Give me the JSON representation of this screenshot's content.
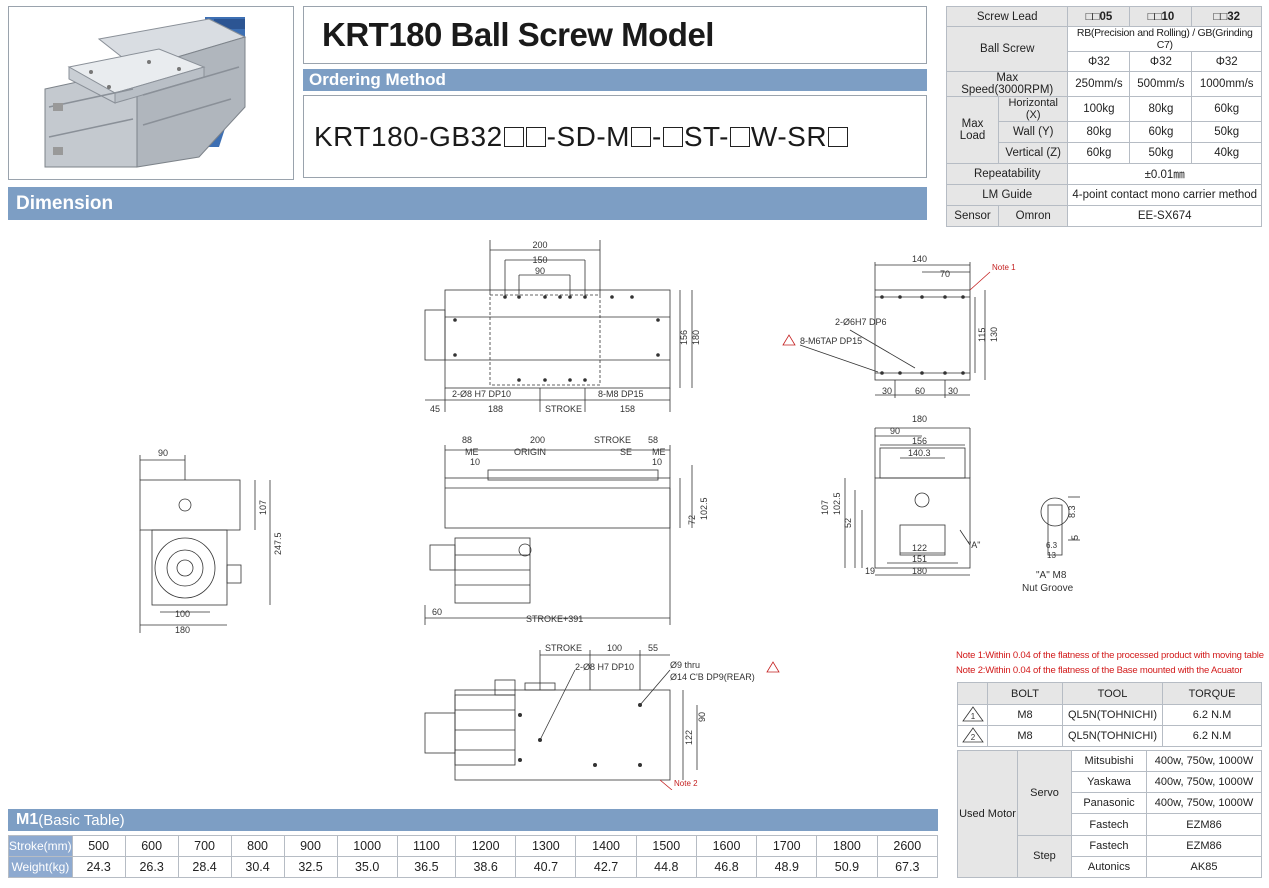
{
  "title": "KRT180 Ball Screw Model",
  "ordering": {
    "header": "Ordering Method",
    "code_parts": [
      "KRT180-GB32",
      "-SD-M",
      "-",
      "ST-",
      "W-SR"
    ]
  },
  "dimension_header": "Dimension",
  "spec": {
    "screw_lead_label": "Screw Lead",
    "leads": [
      "05",
      "10",
      "32"
    ],
    "ball_screw_label": "Ball Screw",
    "ball_screw_type": "RB(Precision and Rolling) / GB(Grinding C7)",
    "diameters": [
      "Φ32",
      "Φ32",
      "Φ32"
    ],
    "max_speed_label": "Max Speed(3000RPM)",
    "max_speeds": [
      "250mm/s",
      "500mm/s",
      "1000mm/s"
    ],
    "max_load_label": "Max Load",
    "loads": [
      {
        "label": "Horizontal (X)",
        "values": [
          "100kg",
          "80kg",
          "60kg"
        ]
      },
      {
        "label": "Wall (Y)",
        "values": [
          "80kg",
          "60kg",
          "50kg"
        ]
      },
      {
        "label": "Vertical (Z)",
        "values": [
          "60kg",
          "50kg",
          "40kg"
        ]
      }
    ],
    "repeatability_label": "Repeatability",
    "repeatability": "±0.01㎜",
    "lm_label": "LM Guide",
    "lm_value": "4-point contact mono carrier method",
    "sensor_label": "Sensor",
    "sensor_brand": "Omron",
    "sensor_model": "EE-SX674"
  },
  "drawing": {
    "top": {
      "d200": "200",
      "d150": "150",
      "d90": "90",
      "d156": "156",
      "d180": "180",
      "hole1": "2-Ø8 H7 DP10",
      "hole2": "8-M8 DP15",
      "d45": "45",
      "d188": "188",
      "stroke": "STROKE",
      "d158": "158"
    },
    "front": {
      "d88": "88",
      "d200": "200",
      "stroke": "STROKE",
      "d58": "58",
      "me": "ME",
      "se": "SE",
      "d10": "10",
      "origin": "ORIGIN",
      "d72": "72",
      "d102": "102.5",
      "d60": "60",
      "total": "STROKE+391"
    },
    "left": {
      "d90": "90",
      "d107": "107",
      "d247": "247.5",
      "d100": "100",
      "d180": "180"
    },
    "table": {
      "d140": "140",
      "d70": "70",
      "note1": "Note 1",
      "hole1": "2-Ø6H7 DP6",
      "hole2": "8-M6TAP DP15",
      "d115": "115",
      "d130": "130",
      "d30a": "30",
      "d60": "60",
      "d30b": "30"
    },
    "end": {
      "d180": "180",
      "d90": "90",
      "d156": "156",
      "d140": "140.3",
      "d107": "107",
      "d102": "102.5",
      "d52": "52",
      "d122": "122",
      "d151": "151",
      "d180b": "180",
      "d19": "19",
      "a": "\"A\""
    },
    "groove": {
      "label": "\"A\" M8",
      "label2": "Nut Groove",
      "d83": "8.3",
      "d5": "5",
      "d63": "6.3",
      "d13": "13"
    },
    "bottom": {
      "stroke": "STROKE",
      "d100": "100",
      "d55": "55",
      "hole1": "2-Ø8 H7 DP10",
      "hole2": "Ø9 thru",
      "hole3": "Ø14 C'B DP9(REAR)",
      "d90": "90",
      "d122": "122",
      "note2": "Note 2"
    }
  },
  "notes": [
    "Note 1:Within 0.04 of the flatness of the processed product with moving table",
    "Note 2:Within 0.04 of the flatness of the Base mounted with the Acuator"
  ],
  "bolt_table": {
    "headers": [
      "BOLT",
      "TOOL",
      "TORQUE"
    ],
    "rows": [
      {
        "mark": "1",
        "bolt": "M8",
        "tool": "QL5N(TOHNICHI)",
        "torque": "6.2 N.M"
      },
      {
        "mark": "2",
        "bolt": "M8",
        "tool": "QL5N(TOHNICHI)",
        "torque": "6.2 N.M"
      }
    ]
  },
  "motor_table": {
    "label": "Used Motor",
    "servo_label": "Servo",
    "step_label": "Step",
    "servo": [
      {
        "brand": "Mitsubishi",
        "value": "400w, 750w, 1000W"
      },
      {
        "brand": "Yaskawa",
        "value": "400w, 750w, 1000W"
      },
      {
        "brand": "Panasonic",
        "value": "400w, 750w, 1000W"
      },
      {
        "brand": "Fastech",
        "value": "EZM86"
      }
    ],
    "step": [
      {
        "brand": "Fastech",
        "value": "EZM86"
      },
      {
        "brand": "Autonics",
        "value": "AK85"
      }
    ]
  },
  "m1": {
    "header_bold": "M1",
    "header_rest": "(Basic Table)",
    "stroke_label": "Stroke(mm)",
    "weight_label": "Weight(kg)",
    "strokes": [
      "500",
      "600",
      "700",
      "800",
      "900",
      "1000",
      "1100",
      "1200",
      "1300",
      "1400",
      "1500",
      "1600",
      "1700",
      "1800",
      "2600"
    ],
    "weights": [
      "24.3",
      "26.3",
      "28.4",
      "30.4",
      "32.5",
      "35.0",
      "36.5",
      "38.6",
      "40.7",
      "42.7",
      "44.8",
      "46.8",
      "48.9",
      "50.9",
      "67.3"
    ]
  }
}
